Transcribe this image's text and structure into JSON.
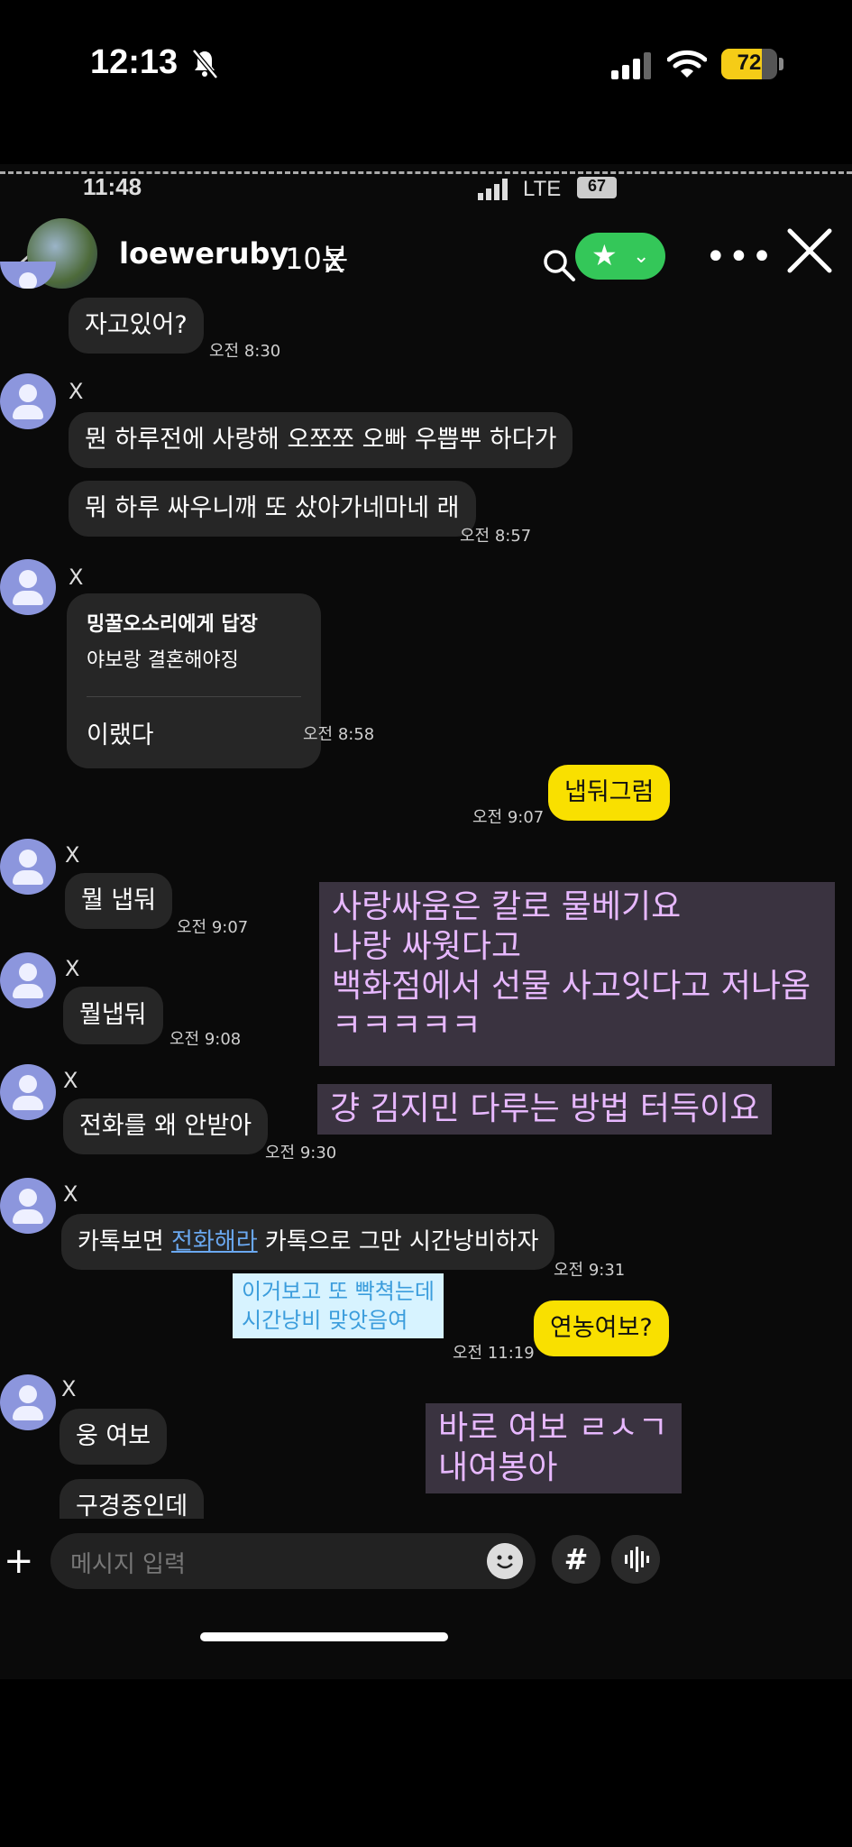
{
  "status_bar": {
    "time": "12:13",
    "battery": "72",
    "battery_level": 0.72
  },
  "inner_status": {
    "time": "11:48",
    "network": "LTE",
    "battery": "67"
  },
  "header": {
    "username": "loeweruby",
    "since": "10분",
    "since_mark": "X"
  },
  "messages": [
    {
      "text": "자고있어?",
      "time": "오전 8:30"
    },
    {
      "sender": "X",
      "text": "뭔 하루전에 사랑해 오쪼쪼 오빠 우쁩뿌 하다가"
    },
    {
      "text": "뭐 하루 싸우니깨 또 샀아가네마네 래",
      "time": "오전 8:57"
    },
    {
      "sender": "X",
      "reply_title": "밍꿀오소리에게 답장",
      "reply_quote": "야보랑 결혼해야징",
      "text": "이랬다",
      "time": "오전 8:58"
    },
    {
      "text": "냅둬그럼",
      "time": "오전 9:07",
      "mine": true
    },
    {
      "sender": "X",
      "text": "뭘 냅둬",
      "time": "오전 9:07"
    },
    {
      "sender": "X",
      "text": "뭘냅둬",
      "time": "오전 9:08"
    },
    {
      "sender": "X",
      "text": "전화를 왜 안받아",
      "time": "오전 9:30"
    },
    {
      "sender": "X",
      "text_before": "카톡보면",
      "link": "전화해라",
      "text_after": "카톡으로 그만 시간낭비하자",
      "time": "오전 9:31"
    },
    {
      "text": "연농여보?",
      "time": "오전 11:19",
      "mine": true
    },
    {
      "sender": "X",
      "text": "웅 여보"
    },
    {
      "text": "구경중인데"
    }
  ],
  "notes": {
    "note1": [
      "사랑싸움은 칼로 물베기요",
      "나랑 싸웟다고",
      "백화점에서 선물 사고잇다고 저나옴",
      "ㅋㅋㅋㅋㅋ"
    ],
    "note2": "걍 김지민 다루는 방법 터득이요",
    "note3": [
      "이거보고 또 빡쳑는데",
      "시간낭비 맞앗음여"
    ],
    "note4": [
      "바로 여보 ㄹㅅㄱ",
      "내여봉아"
    ]
  },
  "input": {
    "placeholder": "메시지 입력"
  }
}
